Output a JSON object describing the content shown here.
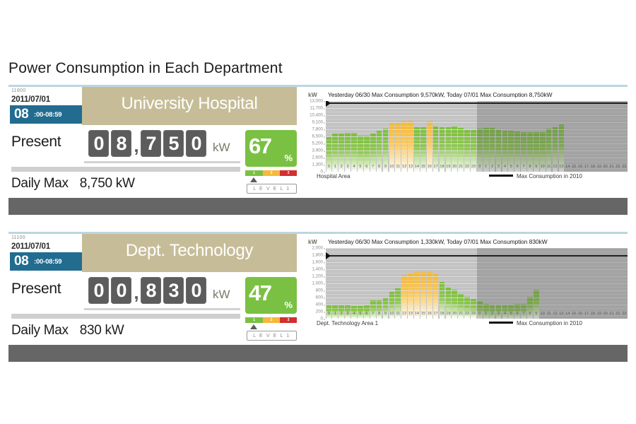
{
  "page": {
    "title": "Power Consumption in Each Department"
  },
  "colors": {
    "accent_teal": "#226c90",
    "banner_tan": "#c6bd98",
    "level_green": "#7ac143",
    "level_amber": "#f6b93b",
    "level_red": "#d32f2f",
    "bar_green": "#7bbf3a",
    "bar_yellow": "#f5b731",
    "plot_bg": "#c3c3c3",
    "dark_bar": "#666666",
    "topline": "#bcd6e0"
  },
  "panels": [
    {
      "tiny_id": "11800",
      "date": "2011/07/01",
      "hour": "08",
      "minute_range": ":00-08:59",
      "department": "University Hospital",
      "present_label": "Present",
      "present_digits": [
        "0",
        "8",
        "7",
        "5",
        "0"
      ],
      "present_comma_after": 2,
      "present_unit": "kW",
      "percent_value": "67",
      "percent_symbol": "%",
      "level_segments": [
        "1",
        "2",
        "3"
      ],
      "level_tag": "L E V E L 1",
      "daily_max_label": "Daily Max",
      "daily_max_value": "8,750 kW",
      "chart": {
        "kw_label": "kW",
        "header": "Yesterday 06/30  Max Consumption 9,570kW,  Today 07/01 Max Consumption 8,750kW",
        "area_label": "Hospital Area",
        "legend_label": "Max Consumption in 2010",
        "chart_data": {
          "type": "bar",
          "title": "Yesterday 06/30  Max Consumption 9,570kW,  Today 07/01 Max Consumption 8,750kW",
          "xlabel": "",
          "ylabel": "kW",
          "ylim": [
            0,
            13000
          ],
          "yticks": [
            13000,
            11700,
            10400,
            9100,
            7800,
            6500,
            5200,
            3900,
            2600,
            1300,
            0
          ],
          "ytick_labels": [
            "13,000",
            "11,700",
            "10,400",
            "9,100",
            "7,800",
            "6,500",
            "5,200",
            "3,900",
            "2,600",
            "1,300",
            "0"
          ],
          "grid": true,
          "legend_position": "bottom-right",
          "max_consumption_2010": 12800,
          "categories": [
            "0",
            "1",
            "2",
            "3",
            "4",
            "5",
            "6",
            "7",
            "8",
            "9",
            "10",
            "11",
            "12",
            "13",
            "14",
            "15",
            "16",
            "17",
            "18",
            "19",
            "20",
            "21",
            "22",
            "23",
            "0",
            "1",
            "2",
            "3",
            "4",
            "5",
            "6",
            "7",
            "8",
            "9",
            "10",
            "11",
            "12",
            "13",
            "14",
            "15",
            "16",
            "17",
            "18",
            "19",
            "20",
            "21",
            "22",
            "23"
          ],
          "series": [
            {
              "name": "Yesterday 06/30",
              "values": [
                6500,
                7000,
                7050,
                7100,
                7100,
                6600,
                6600,
                7000,
                7600,
                7900,
                9100,
                9100,
                9300,
                9300,
                8200,
                8200,
                9300,
                8300,
                8200,
                8200,
                8300,
                8100,
                7700,
                7800
              ]
            },
            {
              "name": "Today 07/01",
              "values": [
                7900,
                8000,
                8000,
                7700,
                7600,
                7600,
                7400,
                7300,
                7300,
                7300,
                7300,
                7900,
                8200,
                8750,
                null,
                null,
                null,
                null,
                null,
                null,
                null,
                null,
                null,
                null
              ]
            }
          ],
          "bar_color_rule": "green under 9,000 kW; amber at or above 9,000 kW"
        }
      }
    },
    {
      "tiny_id": "11100",
      "date": "2011/07/01",
      "hour": "08",
      "minute_range": ":00-08:59",
      "department": "Dept. Technology",
      "present_label": "Present",
      "present_digits": [
        "0",
        "0",
        "8",
        "3",
        "0"
      ],
      "present_comma_after": 2,
      "present_unit": "kW",
      "percent_value": "47",
      "percent_symbol": "%",
      "level_segments": [
        "1",
        "2",
        "3"
      ],
      "level_tag": "L E V E L 1",
      "daily_max_label": "Daily Max",
      "daily_max_value": "830 kW",
      "chart": {
        "kw_label": "kW",
        "header": "Yesterday 06/30  Max Consumption 1,330kW,  Today 07/01 Max Consumption 830kW",
        "area_label": "Dept. Technology  Area 1",
        "legend_label": "Max Consumption in 2010",
        "chart_data": {
          "type": "bar",
          "title": "Yesterday 06/30  Max Consumption 1,330kW,  Today 07/01 Max Consumption 830kW",
          "xlabel": "",
          "ylabel": "kW",
          "ylim": [
            0,
            2000
          ],
          "yticks": [
            2000,
            1800,
            1600,
            1400,
            1200,
            1000,
            800,
            600,
            400,
            200,
            0
          ],
          "ytick_labels": [
            "2,000",
            "1,800",
            "1,600",
            "1,400",
            "1,200",
            "1,000",
            "800",
            "600",
            "400",
            "200",
            "0"
          ],
          "grid": true,
          "legend_position": "bottom-right",
          "max_consumption_2010": 1800,
          "categories": [
            "0",
            "1",
            "2",
            "3",
            "4",
            "5",
            "6",
            "7",
            "8",
            "9",
            "10",
            "11",
            "12",
            "13",
            "14",
            "15",
            "16",
            "17",
            "18",
            "19",
            "20",
            "21",
            "22",
            "23",
            "0",
            "1",
            "2",
            "3",
            "4",
            "5",
            "6",
            "7",
            "8",
            "9",
            "10",
            "11",
            "12",
            "13",
            "14",
            "15",
            "16",
            "17",
            "18",
            "19",
            "20",
            "21",
            "22",
            "23"
          ],
          "series": [
            {
              "name": "Yesterday 06/30",
              "values": [
                400,
                390,
                380,
                380,
                370,
                370,
                380,
                520,
                530,
                600,
                760,
                860,
                1240,
                1290,
                1320,
                1330,
                1320,
                1280,
                1040,
                880,
                820,
                700,
                620,
                560
              ]
            },
            {
              "name": "Today 07/01",
              "values": [
                500,
                430,
                400,
                400,
                400,
                410,
                420,
                430,
                620,
                830,
                null,
                null,
                null,
                null,
                null,
                null,
                null,
                null,
                null,
                null,
                null,
                null,
                null,
                null
              ]
            }
          ],
          "bar_color_rule": "green under 1,150 kW; amber at or above 1,150 kW"
        }
      }
    }
  ]
}
